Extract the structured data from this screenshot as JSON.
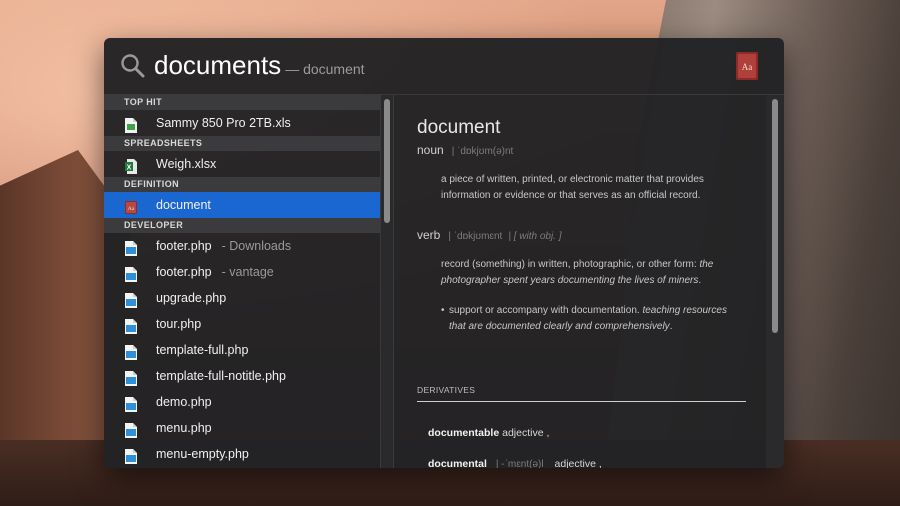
{
  "search": {
    "query": "documents",
    "completion": "— document"
  },
  "results": {
    "sections": [
      {
        "header": "TOP HIT",
        "items": [
          {
            "label": "Sammy 850 Pro 2TB.xls",
            "sub": "",
            "icon": "spreadsheet-doc-icon"
          }
        ]
      },
      {
        "header": "SPREADSHEETS",
        "items": [
          {
            "label": "Weigh.xlsx",
            "sub": "",
            "icon": "excel-file-icon"
          }
        ]
      },
      {
        "header": "DEFINITION",
        "items": [
          {
            "label": "document",
            "sub": "",
            "icon": "dictionary-icon",
            "selected": true
          }
        ]
      },
      {
        "header": "DEVELOPER",
        "items": [
          {
            "label": "footer.php",
            "sub": "- Downloads",
            "icon": "php-file-icon"
          },
          {
            "label": "footer.php",
            "sub": "- vantage",
            "icon": "php-file-icon"
          },
          {
            "label": "upgrade.php",
            "sub": "",
            "icon": "php-file-icon"
          },
          {
            "label": "tour.php",
            "sub": "",
            "icon": "php-file-icon"
          },
          {
            "label": "template-full.php",
            "sub": "",
            "icon": "php-file-icon"
          },
          {
            "label": "template-full-notitle.php",
            "sub": "",
            "icon": "php-file-icon"
          },
          {
            "label": "demo.php",
            "sub": "",
            "icon": "php-file-icon"
          },
          {
            "label": "menu.php",
            "sub": "",
            "icon": "php-file-icon"
          },
          {
            "label": "menu-empty.php",
            "sub": "",
            "icon": "php-file-icon"
          }
        ]
      }
    ]
  },
  "definition": {
    "word": "document",
    "noun": {
      "pos": "noun",
      "pron": "| ˈdɒkjʊm(ə)nt",
      "text": "a piece of written, printed, or electronic matter that provides information or evidence or that serves as an official record."
    },
    "verb": {
      "pos": "verb",
      "pron": "| ˈdɒkjʊmɛnt",
      "note": "| [ with obj. ]",
      "sense1": "record (something) in written, photographic, or other form:",
      "sense1_ex": "the photographer spent years documenting the lives of miners",
      "sense1_end": ".",
      "sense2": "support or accompany with documentation.",
      "sense2_ex": "teaching resources that are documented clearly and comprehensively",
      "sense2_end": "."
    },
    "derivatives_header": "DERIVATIVES",
    "derivatives": [
      {
        "word": "documentable",
        "rest": "adjective ,"
      },
      {
        "word": "documental",
        "pron": "| -ˈmɛnt(ə)l",
        "rest": "adjective ,"
      }
    ]
  },
  "colors": {
    "selection": "#1a67d2",
    "panel": "#222224",
    "section_header": "#3b3b3d"
  }
}
